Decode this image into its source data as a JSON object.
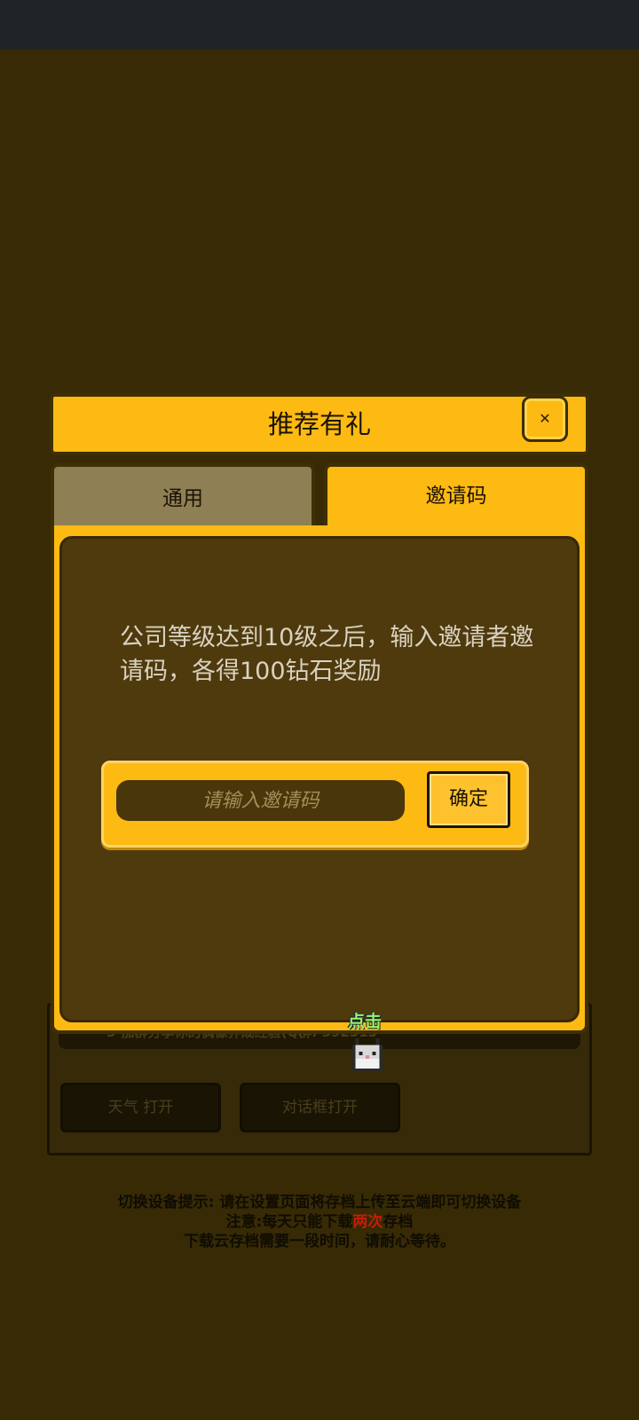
{
  "modal": {
    "title": "推荐有礼",
    "close_icon": "close-icon",
    "tabs": [
      {
        "label": "通用",
        "active": false
      },
      {
        "label": "邀请码",
        "active": true
      }
    ],
    "description": "公司等级达到10级之后，输入邀请者邀请码，各得100钻石奖励",
    "input_placeholder": "请输入邀请码",
    "confirm_label": "确定"
  },
  "background": {
    "info_text": "3-加群分享你的偶像养成经验(Q群: 592315",
    "weather_button": "天气 打开",
    "dialog_button": "对话框打开"
  },
  "tap_hint": "点击",
  "tips": {
    "line1": "切换设备提示: 请在设置页面将存档上传至云端即可切换设备",
    "line2_prefix": "注意:每天只能下载",
    "line2_highlight": "两次",
    "line2_suffix": "存档",
    "line3": "下载云存档需要一段时间，请耐心等待。"
  },
  "colors": {
    "accent": "#fdba12",
    "panel": "#4f3a0d",
    "warning": "#c41c0c"
  }
}
